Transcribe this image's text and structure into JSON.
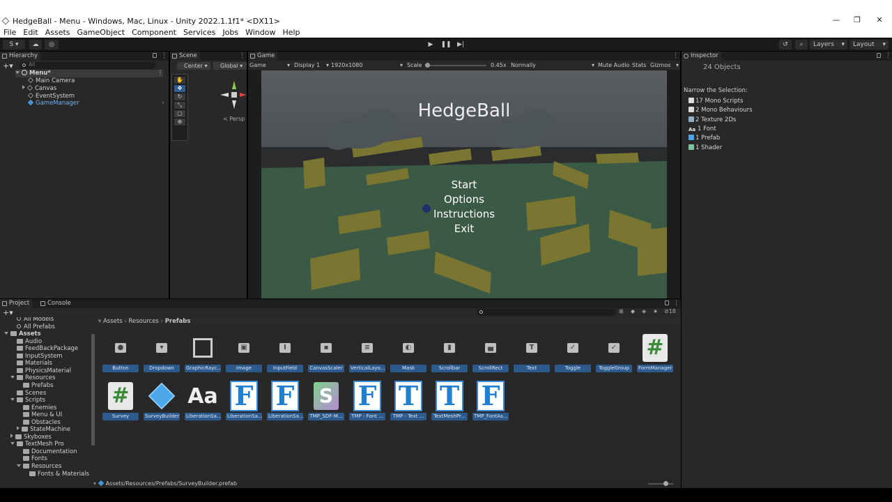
{
  "window": {
    "title": "HedgeBall - Menu - Windows, Mac, Linux - Unity 2022.1.1f1* <DX11>",
    "minimize": "—",
    "maximize": "❐",
    "close": "✕"
  },
  "menu": [
    "File",
    "Edit",
    "Assets",
    "GameObject",
    "Component",
    "Services",
    "Jobs",
    "Window",
    "Help"
  ],
  "toolbar": {
    "account": "S",
    "layers": "Layers",
    "layout": "Layout"
  },
  "hierarchy": {
    "tab": "Hierarchy",
    "search_placeholder": "All",
    "scene": "Menu*",
    "items": [
      "Main Camera",
      "Canvas",
      "EventSystem",
      "GameManager"
    ]
  },
  "scene": {
    "tab": "Scene",
    "pivot": "Center",
    "space": "Global",
    "persp": "Persp"
  },
  "game": {
    "tab": "Game",
    "view": "Game",
    "display": "Display 1",
    "resolution": "1920x1080",
    "scale_label": "Scale",
    "scale_value": "0.45x",
    "play_mode": "Normally",
    "mute": "Mute Audio",
    "stats": "Stats",
    "gizmos": "Gizmos",
    "title": "HedgeBall",
    "menu_items": [
      "Start",
      "Options",
      "Instructions",
      "Exit"
    ]
  },
  "inspector": {
    "tab": "Inspector",
    "count": "24 Objects",
    "narrow": "Narrow the Selection:",
    "items": [
      "17 Mono Scripts",
      "2 Mono Behaviours",
      "2 Texture 2Ds",
      "1 Font",
      "1 Prefab",
      "1 Shader"
    ],
    "item_icons": [
      "script-icon",
      "script-icon",
      "texture-icon",
      "font-icon",
      "prefab-icon",
      "shader-icon"
    ]
  },
  "project": {
    "tabs": [
      "Project",
      "Console"
    ],
    "badge": "18",
    "breadcrumb": [
      "Assets",
      "Resources",
      "Prefabs"
    ],
    "tree": [
      {
        "label": "All Models",
        "indent": 1,
        "kind": "search"
      },
      {
        "label": "All Prefabs",
        "indent": 1,
        "kind": "search"
      },
      {
        "label": "Assets",
        "indent": 0,
        "kind": "folder-open",
        "bold": true
      },
      {
        "label": "Audio",
        "indent": 1,
        "kind": "folder"
      },
      {
        "label": "FeedBackPackage",
        "indent": 1,
        "kind": "folder"
      },
      {
        "label": "InputSystem",
        "indent": 1,
        "kind": "folder"
      },
      {
        "label": "Materials",
        "indent": 1,
        "kind": "folder"
      },
      {
        "label": "PhysicsMaterial",
        "indent": 1,
        "kind": "folder"
      },
      {
        "label": "Resources",
        "indent": 1,
        "kind": "folder-open"
      },
      {
        "label": "Prefabs",
        "indent": 2,
        "kind": "folder"
      },
      {
        "label": "Scenes",
        "indent": 1,
        "kind": "folder"
      },
      {
        "label": "Scripts",
        "indent": 1,
        "kind": "folder-open"
      },
      {
        "label": "Enemies",
        "indent": 2,
        "kind": "folder"
      },
      {
        "label": "Menu & UI",
        "indent": 2,
        "kind": "folder"
      },
      {
        "label": "Obstacles",
        "indent": 2,
        "kind": "folder"
      },
      {
        "label": "StateMachine",
        "indent": 2,
        "kind": "folder-closed"
      },
      {
        "label": "Skyboxes",
        "indent": 1,
        "kind": "folder-closed"
      },
      {
        "label": "TextMesh Pro",
        "indent": 1,
        "kind": "folder-open"
      },
      {
        "label": "Documentation",
        "indent": 2,
        "kind": "folder"
      },
      {
        "label": "Fonts",
        "indent": 2,
        "kind": "folder"
      },
      {
        "label": "Resources",
        "indent": 2,
        "kind": "folder-open"
      },
      {
        "label": "Fonts & Materials",
        "indent": 3,
        "kind": "folder"
      }
    ],
    "row1": [
      {
        "label": "Button",
        "icon": "button-icon"
      },
      {
        "label": "Dropdown",
        "icon": "dropdown-icon"
      },
      {
        "label": "GraphicRayc...",
        "icon": "graphic-raycaster-icon"
      },
      {
        "label": "Image",
        "icon": "image-icon"
      },
      {
        "label": "InputField",
        "icon": "input-field-icon"
      },
      {
        "label": "CanvasScaler",
        "icon": "canvas-scaler-icon"
      },
      {
        "label": "VerticalLayo...",
        "icon": "vertical-layout-icon"
      },
      {
        "label": "Mask",
        "icon": "mask-icon"
      },
      {
        "label": "Scrollbar",
        "icon": "scrollbar-icon"
      },
      {
        "label": "ScrollRect",
        "icon": "scroll-rect-icon"
      },
      {
        "label": "Text",
        "icon": "text-icon"
      },
      {
        "label": "Toggle",
        "icon": "toggle-icon"
      },
      {
        "label": "ToggleGroup",
        "icon": "toggle-group-icon"
      },
      {
        "label": "FormManager",
        "icon": "csharp-script-icon"
      }
    ],
    "row2": [
      {
        "label": "Survey",
        "icon": "csharp-script-icon"
      },
      {
        "label": "SurveyBuilder",
        "icon": "prefab-icon"
      },
      {
        "label": "LiberationSa...",
        "icon": "font-icon"
      },
      {
        "label": "LiberationSa...",
        "icon": "font-asset-icon"
      },
      {
        "label": "LiberationSa...",
        "icon": "font-asset-icon"
      },
      {
        "label": "TMP_SDF-M...",
        "icon": "shader-icon"
      },
      {
        "label": "TMP - Font ...",
        "icon": "font-asset-icon"
      },
      {
        "label": "TMP - Text ...",
        "icon": "text-asset-icon"
      },
      {
        "label": "TextMeshPr...",
        "icon": "text-asset-icon"
      },
      {
        "label": "TMP_FontAs...",
        "icon": "font-asset-icon"
      }
    ],
    "footer_path": "Assets/Resources/Prefabs/SurveyBuilder.prefab"
  }
}
